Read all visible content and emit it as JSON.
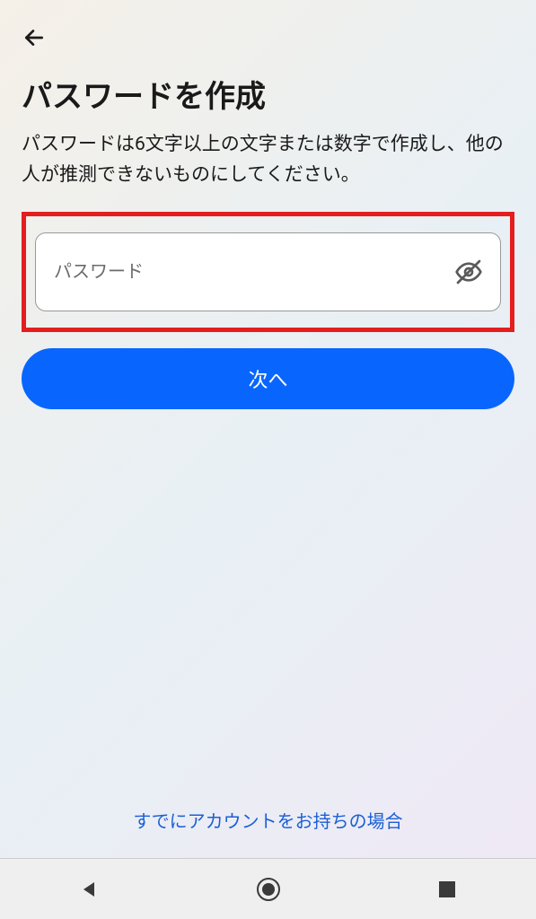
{
  "header": {
    "title": "パスワードを作成",
    "description": "パスワードは6文字以上の文字または数字で作成し、他の人が推測できないものにしてください。"
  },
  "form": {
    "password_placeholder": "パスワード",
    "password_value": "",
    "next_button_label": "次へ"
  },
  "footer": {
    "existing_account_label": "すでにアカウントをお持ちの場合"
  }
}
